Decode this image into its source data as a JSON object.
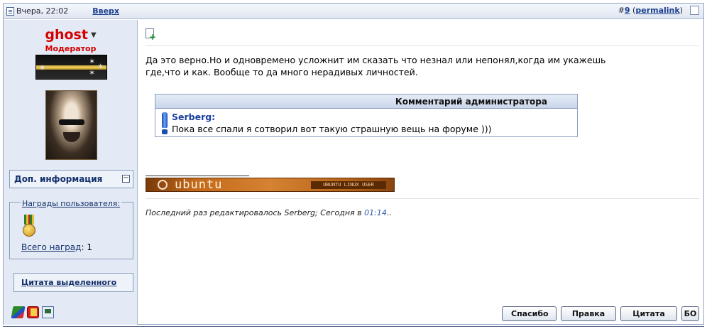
{
  "header": {
    "date": "Вчера, 22:02",
    "top_link": "Вверх",
    "post_number_prefix": "#",
    "post_number": "9",
    "permalink_label": "permalink"
  },
  "user": {
    "name": "ghost",
    "title": "Модератор",
    "more_info_label": "Доп. информация",
    "awards_label": "Награды пользователя:",
    "total_awards_label": "Всего наград",
    "total_awards_count": "1",
    "multiquote_label": "Цитата выделенного"
  },
  "post": {
    "text": "Да это верно.Но и одновремено усложнит им сказать что незнал или непонял,когда им укажешь где,что и как. Вообще то да много нерадивых личностей.",
    "admin_comment_title": "Комментарий администратора",
    "admin_comment_author": "Serberg:",
    "admin_comment_text": "Пока все спали я сотворил вот такую страшную вещь на форуме )))",
    "signature_word": "ubuntu",
    "signature_tag": "UBUNTU LINUX USER",
    "edited_prefix": "Последний раз редактировалось Serberg; Сегодня в",
    "edited_time": "01:14",
    "edited_suffix": ".."
  },
  "buttons": {
    "thanks": "Спасибо",
    "edit": "Правка",
    "quote": "Цитата",
    "quick": "БО"
  },
  "colors": {
    "username": "#d40000",
    "link": "#1a3f8f",
    "sidebar_bg": "#e3eaf5",
    "signature_orange": "#c46a1a"
  }
}
